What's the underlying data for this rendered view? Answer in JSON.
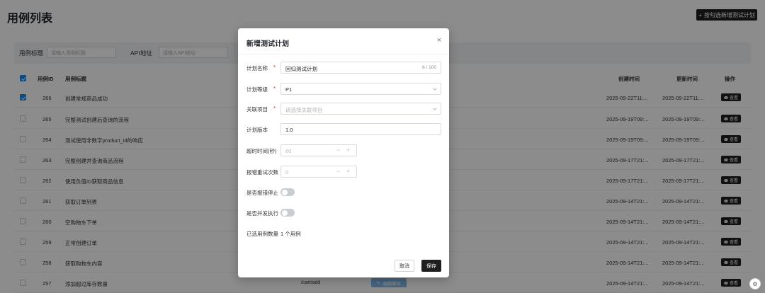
{
  "page": {
    "title": "用例列表",
    "header_button": "按勾选新增测试计划"
  },
  "filters": [
    {
      "label": "用例标题",
      "placeholder": "请输入用例标题"
    },
    {
      "label": "API地址",
      "placeholder": "请输入API地址"
    }
  ],
  "table": {
    "headers": {
      "id": "用例ID",
      "title": "用例标题",
      "created": "创建时间",
      "updated": "更新时间",
      "ops": "操作"
    },
    "view_label": "查看",
    "rows": [
      {
        "id": "266",
        "title": "创建常规商品成功",
        "created": "2025-09-22T11:...",
        "updated": "2025-09-22T11:...",
        "checked": true
      },
      {
        "id": "265",
        "title": "完整测试创建后查询的流程",
        "created": "2025-09-19T09:...",
        "updated": "2025-09-19T09:...",
        "checked": false
      },
      {
        "id": "264",
        "title": "测试使用非数字product_id的响应",
        "created": "2025-09-19T09:...",
        "updated": "2025-09-19T09:...",
        "checked": false
      },
      {
        "id": "263",
        "title": "完整创建并查询商品流程",
        "created": "2025-09-17T21:...",
        "updated": "2025-09-17T21:...",
        "checked": false
      },
      {
        "id": "262",
        "title": "使用负值ID获取商品信息",
        "created": "2025-09-17T21:...",
        "updated": "2025-09-17T21:...",
        "checked": false
      },
      {
        "id": "261",
        "title": "获取订单列表",
        "created": "2025-09-14T21:...",
        "updated": "2025-09-14T21:...",
        "checked": false
      },
      {
        "id": "260",
        "title": "空购物车下单",
        "created": "2025-09-14T21:...",
        "updated": "2025-09-14T21:...",
        "checked": false
      },
      {
        "id": "259",
        "title": "正常创建订单",
        "created": "2025-09-14T21:...",
        "updated": "2025-09-14T21:...",
        "checked": false
      },
      {
        "id": "258",
        "title": "获取购物车内容",
        "created": "2025-09-14T21:...",
        "updated": "2025-09-14T21:...",
        "checked": false
      },
      {
        "id": "257",
        "title": "添加超过库存数量",
        "created": "2025-09-14T21:...",
        "updated": "2025-09-14T21:...",
        "checked": false
      }
    ],
    "last_row_api": "/cart/add",
    "last_row_action": "编辑脚本"
  },
  "modal": {
    "title": "新增测试计划",
    "close": "×",
    "fields": {
      "name_label": "计划名称",
      "name_value": "回归测试计划",
      "name_count": "6 / 100",
      "level_label": "计划等级",
      "level_value": "P1",
      "project_label": "关联项目",
      "project_placeholder": "请选择关联项目",
      "version_label": "计划版本",
      "version_value": "1.0",
      "timeout_label": "超时时间(秒)",
      "timeout_value": "60",
      "retry_label": "报错重试次数",
      "retry_value": "0",
      "stop_label": "是否报错停止",
      "parallel_label": "是否并发执行",
      "selected_label": "已选用例数量",
      "selected_value": "1 个用例"
    },
    "required_mark": "*",
    "stepper_controls": "− +",
    "cancel": "取消",
    "save": "保存"
  }
}
